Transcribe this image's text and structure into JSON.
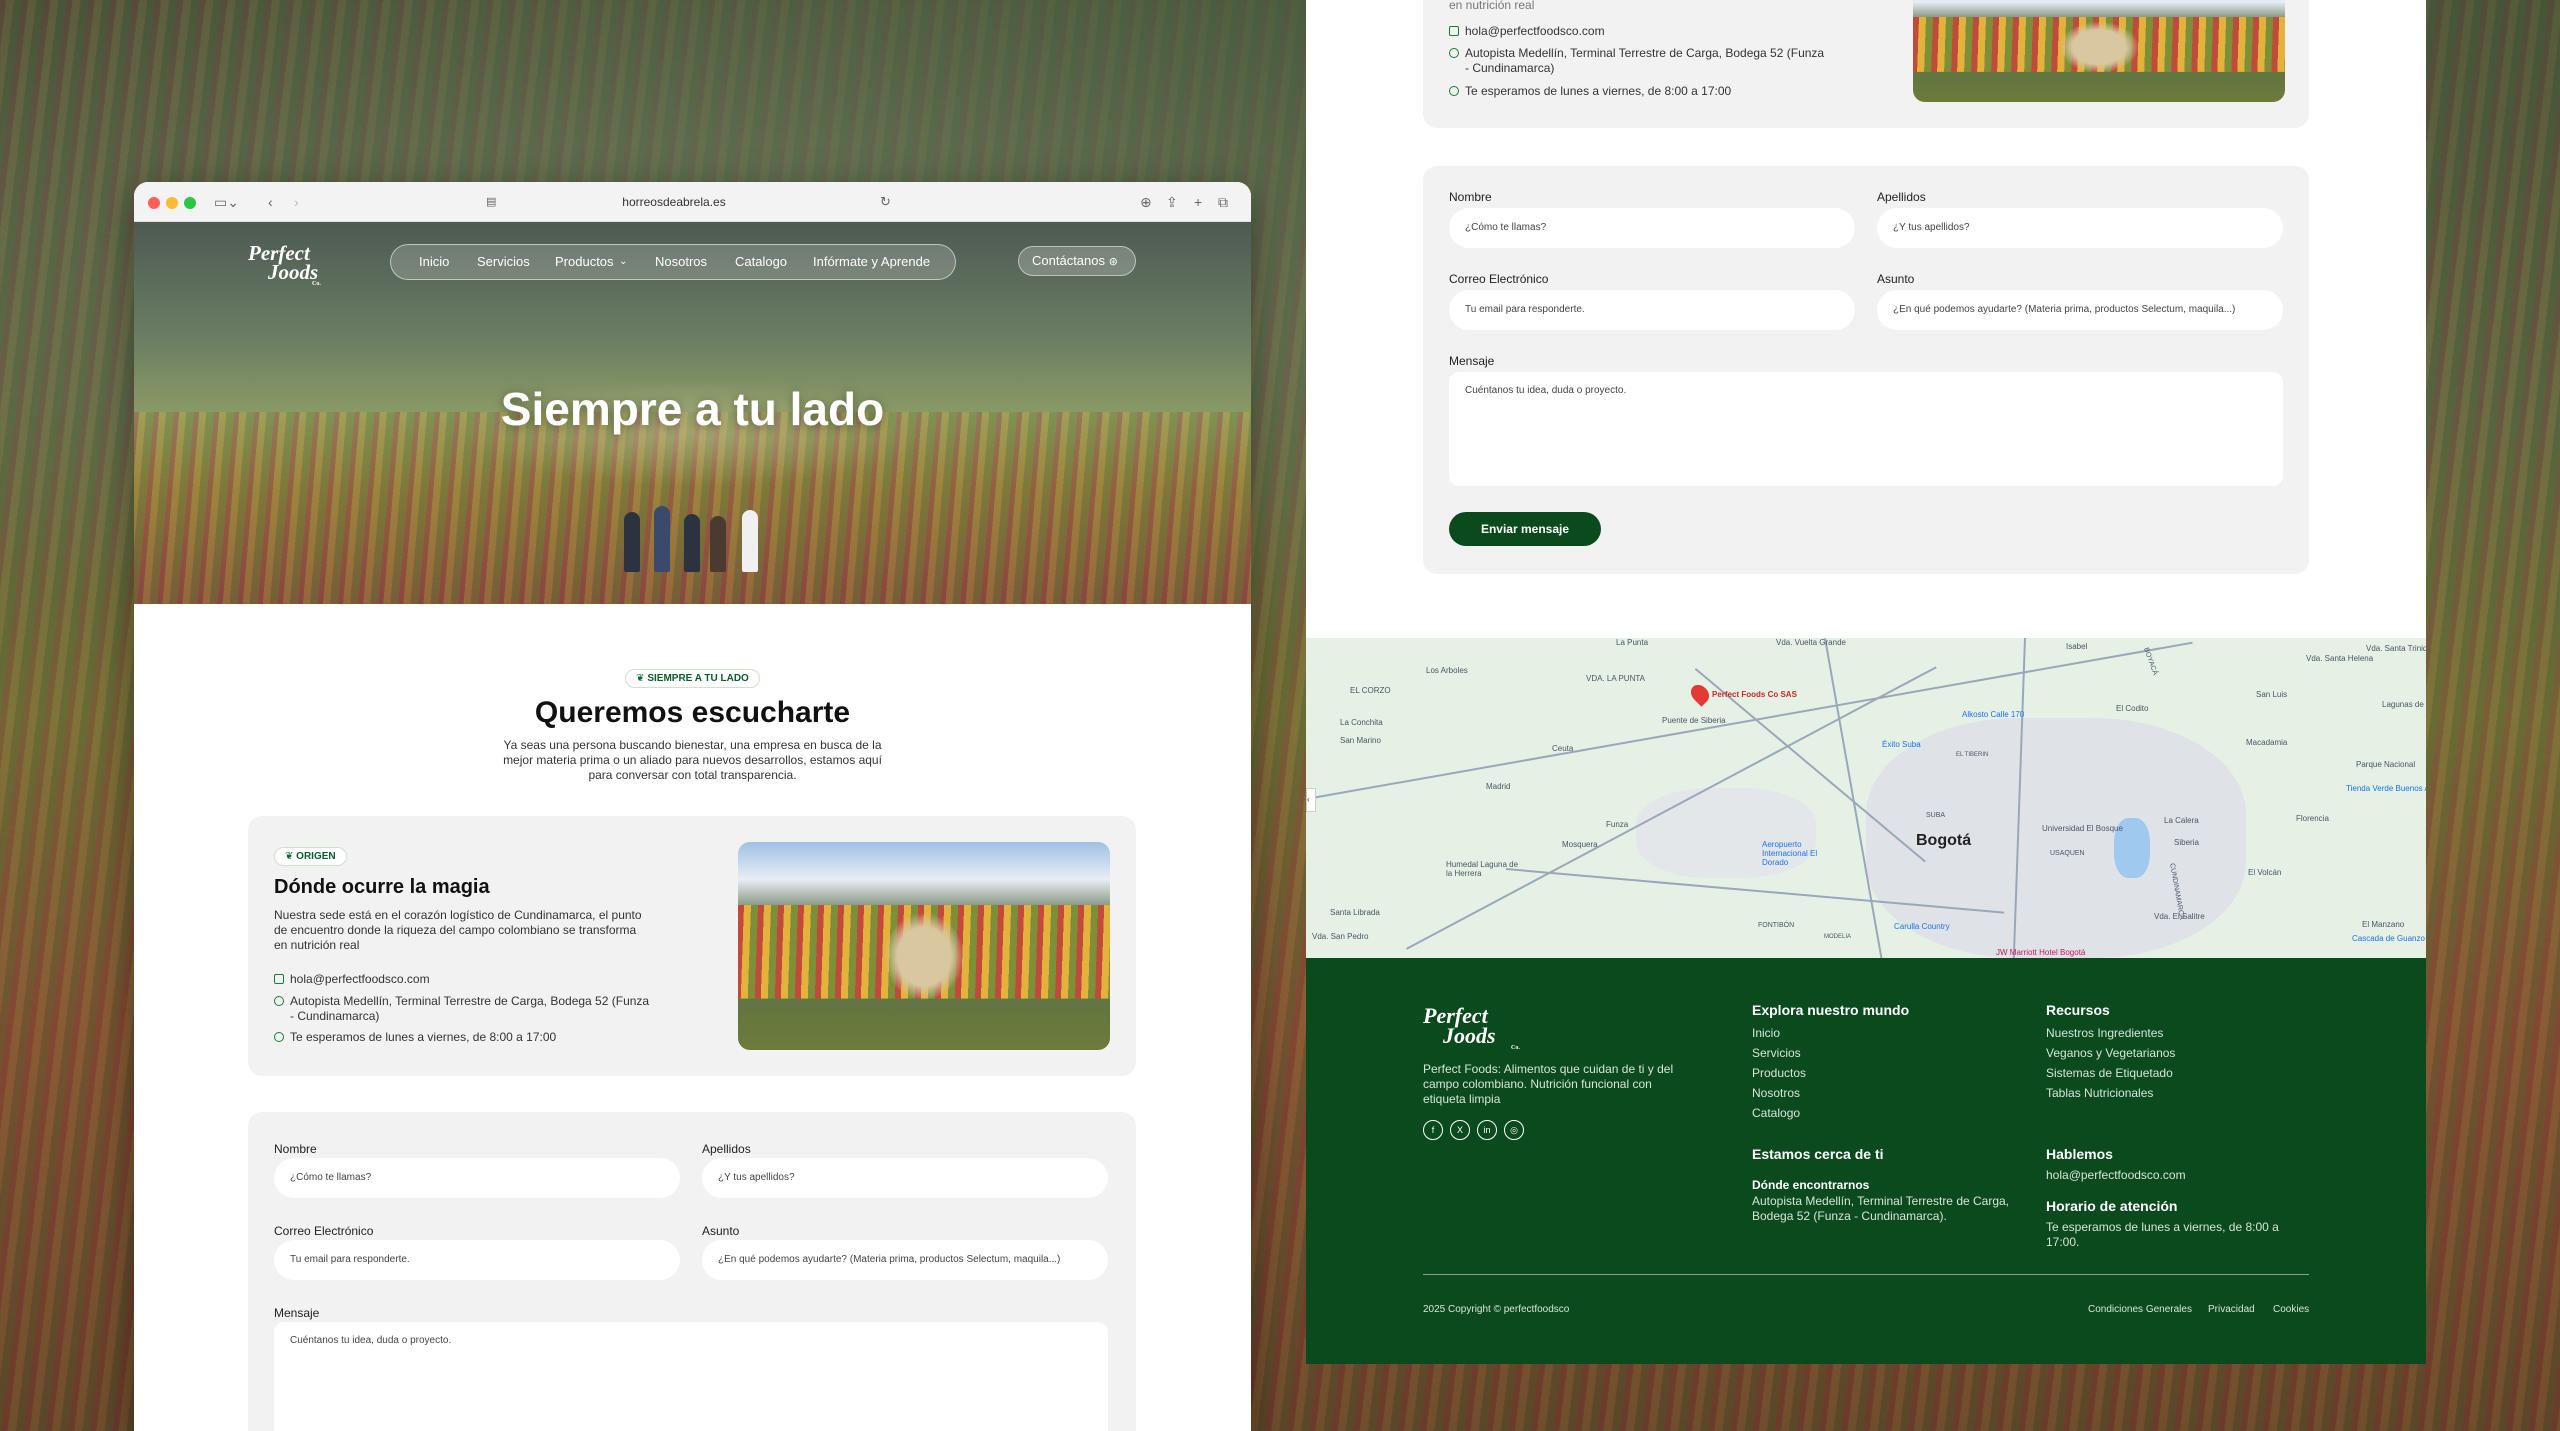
{
  "browser": {
    "url": "horreosdeabrela.es"
  },
  "nav": {
    "logo_line1": "Perfect",
    "logo_line2": "Joods",
    "logo_co": "Co.",
    "items": [
      "Inicio",
      "Servicios",
      "Productos",
      "Nosotros",
      "Catalogo",
      "Infórmate y Aprende"
    ],
    "cta": "Contáctanos"
  },
  "hero": {
    "title": "Siempre a tu lado"
  },
  "intro": {
    "badge": "SIEMPRE A TU LADO",
    "title": "Queremos escucharte",
    "text_lines": [
      "Ya seas una persona buscando bienestar, una empresa en busca de la",
      "mejor materia prima o un aliado para nuevos desarrollos, estamos aquí",
      "para conversar con total transparencia."
    ]
  },
  "origin": {
    "badge": "ORIGEN",
    "title": "Dónde ocurre la magia",
    "text_lines": [
      "Nuestra sede está en el corazón logístico de Cundinamarca, el punto",
      "de encuentro donde la riqueza del campo colombiano se transforma",
      "en nutrición real"
    ],
    "email": "hola@perfectfoodsco.com",
    "address_lines": [
      "Autopista Medellín, Terminal Terrestre de Carga, Bodega 52 (Funza",
      "- Cundinamarca)"
    ],
    "hours": "Te esperamos de lunes a viernes, de 8:00 a 17:00"
  },
  "form": {
    "nombre_label": "Nombre",
    "nombre_ph": "¿Cómo te llamas?",
    "apellidos_label": "Apellidos",
    "apellidos_ph": "¿Y tus apellidos?",
    "email_label": "Correo Electrónico",
    "email_ph": "Tu email para responderte.",
    "asunto_label": "Asunto",
    "asunto_ph": "¿En qué podemos ayudarte? (Materia prima, productos Selectum, maquila...)",
    "mensaje_label": "Mensaje",
    "mensaje_ph": "Cuéntanos tu idea, duda o proyecto.",
    "submit": "Enviar mensaje"
  },
  "panel_top": {
    "cut_text": "en nutrición real"
  },
  "map": {
    "pin": "Perfect Foods Co SAS",
    "city": "Bogotá",
    "places": [
      "Los Arboles",
      "La Punta",
      "Vda. Vuelta Grande",
      "Isabel",
      "Vda. Santa Helena",
      "Vda. Santa Trinidad",
      "EL CORZO",
      "VDA. LA PUNTA",
      "Puente de Siberia",
      "Alkosto Calle 170",
      "El Codito",
      "San Luis",
      "La Conchita",
      "San Marino",
      "Ceuta",
      "Éxito Suba",
      "EL TIBERIN",
      "Macadamia",
      "Lagunas de",
      "Parque Nacional",
      "Madrid",
      "SUBA",
      "Tienda Verde Buenos Aires",
      "Mosquera",
      "Funza",
      "Aeropuerto Internacional El Dorado",
      "Universidad El Bosque",
      "La Calera",
      "Florencia",
      "Siberia",
      "El Volcán",
      "Humedal Laguna de la Herrera",
      "USAQUEN",
      "Santa Librada",
      "Vda. San Pedro",
      "FONTIBÓN",
      "Carulla Country",
      "Vda. El Salitre",
      "El Manzano",
      "JW Marriott Hotel Bogotá",
      "Cascada de Guanzo",
      "CUNDINAMARCA",
      "BOYACÁ",
      "MODELIA"
    ]
  },
  "footer": {
    "desc_lines": [
      "Perfect Foods: Alimentos que cuidan de ti y del",
      "campo colombiano. Nutrición funcional con",
      "etiqueta limpia"
    ],
    "social": [
      "f",
      "X",
      "in",
      "◎"
    ],
    "explora_title": "Explora nuestro mundo",
    "explora": [
      "Inicio",
      "Servicios",
      "Productos",
      "Nosotros",
      "Catalogo"
    ],
    "recursos_title": "Recursos",
    "recursos": [
      "Nuestros Ingredientes",
      "Veganos y Vegetarianos",
      "Sistemas de Etiquetado",
      "Tablas Nutricionales"
    ],
    "cerca_title": "Estamos cerca de ti",
    "donde_title": "Dónde encontrarnos",
    "donde_lines": [
      "Autopista Medellín, Terminal Terrestre de Carga,",
      "Bodega 52 (Funza - Cundinamarca)."
    ],
    "hablemos_title": "Hablemos",
    "hablemos_email": "hola@perfectfoodsco.com",
    "horario_title": "Horario de atención",
    "horario_lines": [
      "Te esperamos de lunes a viernes, de 8:00 a",
      "17:00."
    ],
    "copyright": "2025 Copyright © perfectfoodsco",
    "legal": [
      "Condiciones Generales",
      "Privacidad",
      "Cookies"
    ]
  },
  "colors": {
    "brand_green": "#0b4a1d",
    "accent_green": "#0a6a30"
  }
}
